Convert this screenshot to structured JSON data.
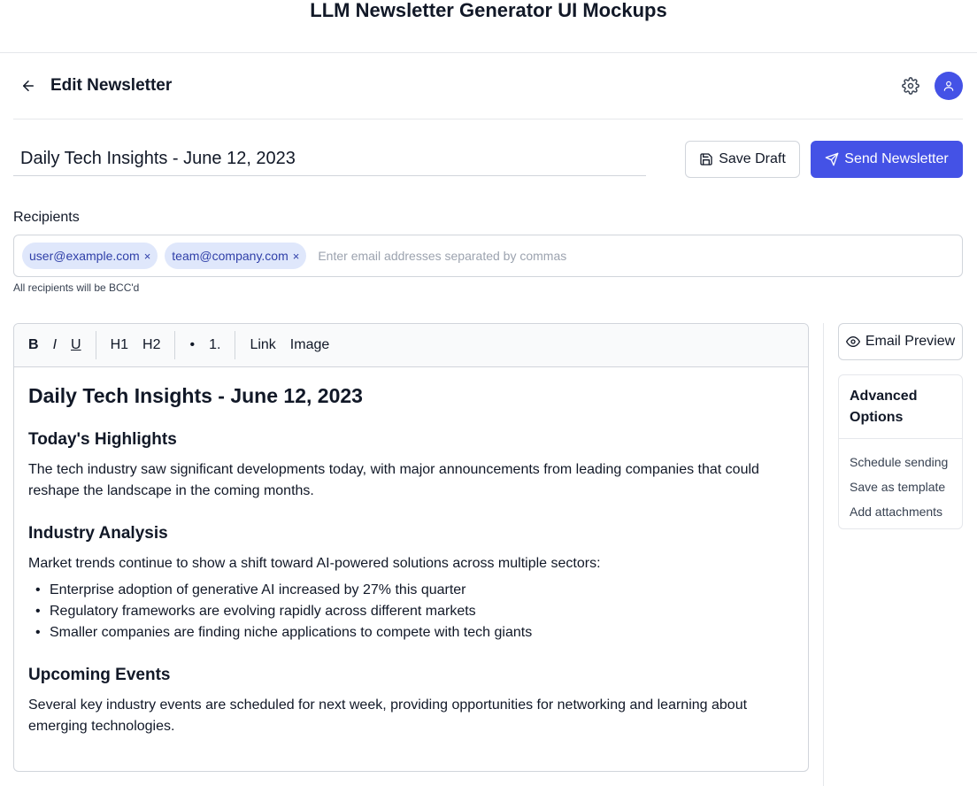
{
  "mockup": {
    "title": "LLM Newsletter Generator UI Mockups"
  },
  "header": {
    "title": "Edit Newsletter",
    "back_icon": "arrow-left-icon",
    "settings_icon": "gear-icon",
    "avatar_icon": "user-icon",
    "accent_color": "#4452e6"
  },
  "newsletter": {
    "title_value": "Daily Tech Insights - June 12, 2023"
  },
  "actions": {
    "save_draft_label": "Save Draft",
    "send_label": "Send Newsletter",
    "save_icon": "floppy-disk-icon",
    "send_icon": "paper-plane-icon"
  },
  "recipients": {
    "label": "Recipients",
    "chips": [
      {
        "email": "user@example.com",
        "remove": "×"
      },
      {
        "email": "team@company.com",
        "remove": "×"
      }
    ],
    "placeholder": "Enter email addresses separated by commas",
    "note": "All recipients will be BCC'd"
  },
  "toolbar": {
    "bold": "B",
    "italic": "I",
    "underline": "U",
    "h1": "H1",
    "h2": "H2",
    "bullet": "•",
    "numbered": "1.",
    "link": "Link",
    "image": "Image"
  },
  "content": {
    "heading": "Daily Tech Insights - June 12, 2023",
    "sections": [
      {
        "title": "Today's Highlights",
        "text": "The tech industry saw significant developments today, with major announcements from leading companies that could reshape the landscape in the coming months."
      },
      {
        "title": "Industry Analysis",
        "text": "Market trends continue to show a shift toward AI-powered solutions across multiple sectors:",
        "bullets": [
          "Enterprise adoption of generative AI increased by 27% this quarter",
          "Regulatory frameworks are evolving rapidly across different markets",
          "Smaller companies are finding niche applications to compete with tech giants"
        ]
      },
      {
        "title": "Upcoming Events",
        "text": "Several key industry events are scheduled for next week, providing opportunities for networking and learning about emerging technologies."
      }
    ]
  },
  "sidebar": {
    "preview_label": "Email Preview",
    "preview_icon": "eye-icon",
    "advanced_title": "Advanced Options",
    "options": [
      "Schedule sending",
      "Save as template",
      "Add attachments"
    ]
  }
}
